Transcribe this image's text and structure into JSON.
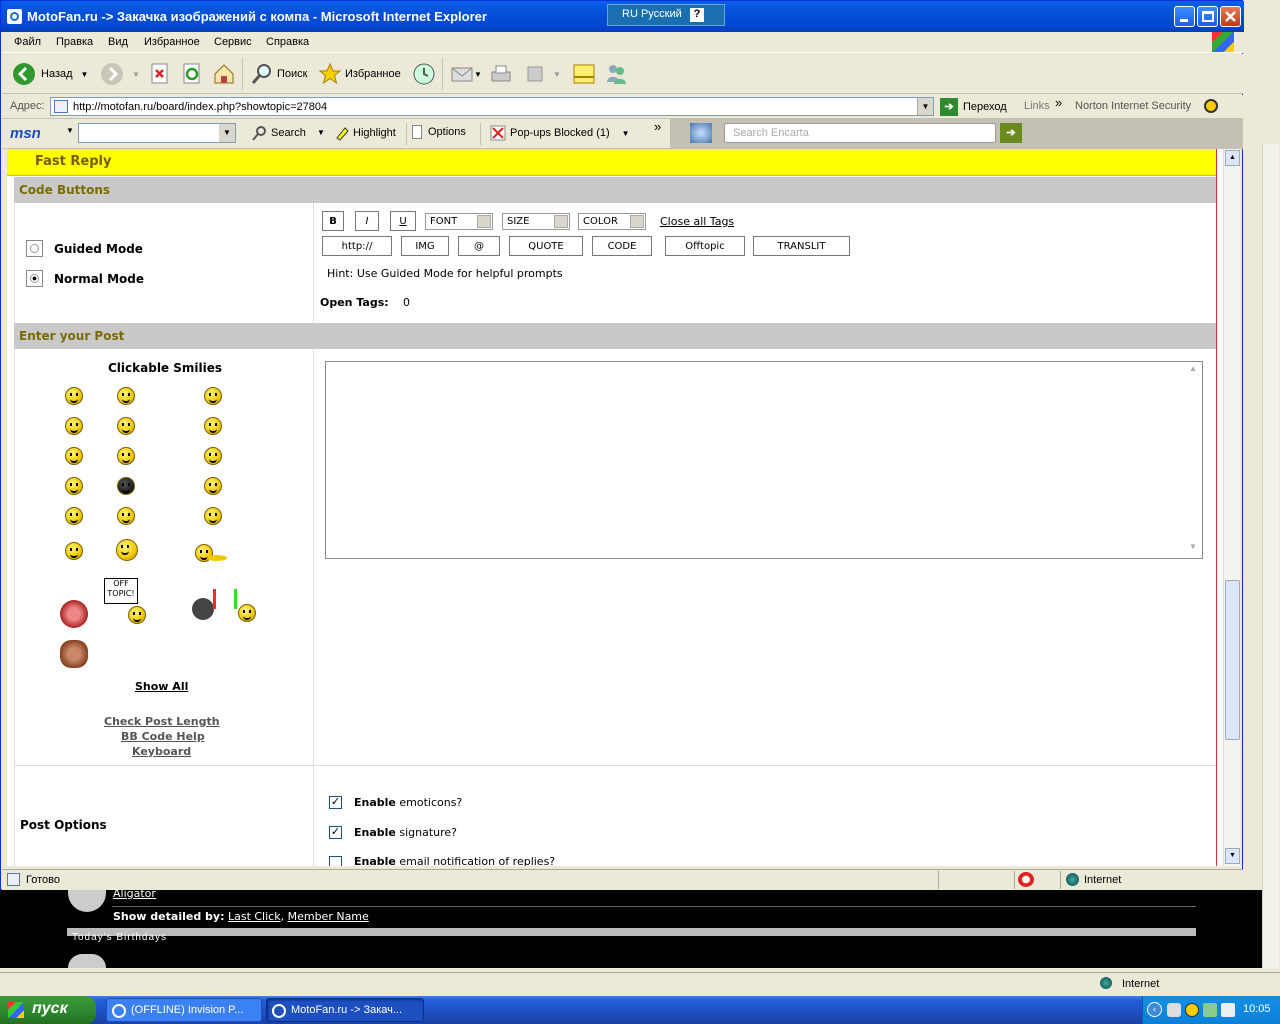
{
  "window": {
    "title": "MotoFan.ru -> Закачка изображений с компа - Microsoft Internet Explorer",
    "language_indicator": "RU Русский"
  },
  "menu": [
    "Файл",
    "Правка",
    "Вид",
    "Избранное",
    "Сервис",
    "Справка"
  ],
  "toolbar": {
    "back": "Назад",
    "search": "Поиск",
    "favorites": "Избранное"
  },
  "address": {
    "label": "Адрес:",
    "url": "http://motofan.ru/board/index.php?showtopic=27804",
    "go": "Переход",
    "links": "Links",
    "norton": "Norton Internet Security"
  },
  "msn": {
    "logo": "msn",
    "search": "Search",
    "highlight": "Highlight",
    "options": "Options",
    "popups": "Pop-ups Blocked (1)",
    "encarta_placeholder": "Search Encarta"
  },
  "form": {
    "fast_reply": "Fast Reply",
    "code_buttons_header": "Code Buttons",
    "guided_mode": "Guided Mode",
    "normal_mode": "Normal Mode",
    "buttons_row1": {
      "bold": "B",
      "italic": "I",
      "underline": "U",
      "close_all": "Close all Tags"
    },
    "selects": {
      "font": "FONT",
      "size": "SIZE",
      "color": "COLOR"
    },
    "buttons_row2": [
      "http://",
      "IMG",
      "@",
      "QUOTE",
      "CODE",
      "Offtopic",
      "TRANSLIT"
    ],
    "hint": "Hint: Use Guided Mode for helpful prompts",
    "open_tags_label": "Open Tags:",
    "open_tags_value": "0",
    "enter_post_header": "Enter your Post",
    "smilies_title": "Clickable Smilies",
    "offtopic_sign": "OFF TOPIC!",
    "show_all": "Show All",
    "links": [
      "Check Post Length",
      "BB Code Help",
      "Keyboard"
    ],
    "post_options_label": "Post Options",
    "options": [
      {
        "bold": "Enable",
        "rest": " emoticons?",
        "checked": true
      },
      {
        "bold": "Enable",
        "rest": " signature?",
        "checked": true
      },
      {
        "bold": "Enable",
        "rest": " email notification of replies?",
        "checked": false
      }
    ]
  },
  "status": {
    "text": "Готово",
    "zone": "Internet"
  },
  "background_page": {
    "user": "Aligator",
    "show_detailed": "Show detailed by:",
    "last_click": "Last Click",
    "member_name": "Member Name",
    "birthdays": "Today's Birthdays",
    "zone": "Internet"
  },
  "taskbar": {
    "start": "пуск",
    "tasks": [
      "(OFFLINE) Invision P...",
      "MotoFan.ru -> Закач..."
    ],
    "clock": "10:05"
  }
}
